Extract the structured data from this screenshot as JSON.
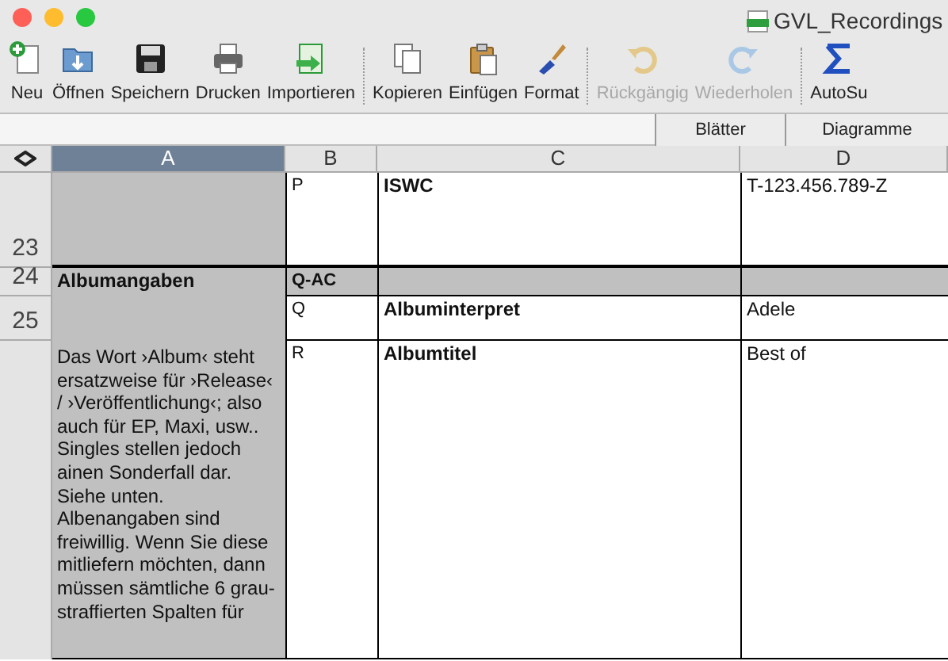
{
  "window": {
    "title": "GVL_Recordings"
  },
  "toolbar": [
    {
      "label": "Neu",
      "disabled": false
    },
    {
      "label": "Öffnen",
      "disabled": false
    },
    {
      "label": "Speichern",
      "disabled": false
    },
    {
      "label": "Drucken",
      "disabled": false
    },
    {
      "label": "Importieren",
      "disabled": false
    },
    {
      "label": "Kopieren",
      "disabled": false
    },
    {
      "label": "Einfügen",
      "disabled": false
    },
    {
      "label": "Format",
      "disabled": false
    },
    {
      "label": "Rückgängig",
      "disabled": true
    },
    {
      "label": "Wiederholen",
      "disabled": true
    },
    {
      "label": "AutoSu",
      "disabled": false
    }
  ],
  "ribbon_tabs": [
    {
      "label": "Blätter"
    },
    {
      "label": "Diagramme"
    }
  ],
  "columns": [
    {
      "label": "A",
      "selected": true
    },
    {
      "label": "B",
      "selected": false
    },
    {
      "label": "C",
      "selected": false
    },
    {
      "label": "D",
      "selected": false
    }
  ],
  "rows": [
    {
      "number": "23",
      "cells": [
        "",
        "P",
        "ISWC",
        "T-123.456.789-Z"
      ]
    },
    {
      "number": "24",
      "cells": [
        "Albumangaben",
        "Q-AC",
        "",
        ""
      ]
    },
    {
      "number": "25",
      "cells": [
        "",
        "Q",
        "Albuminterpret",
        "Adele"
      ]
    },
    {
      "cells": [
        "Das Wort ›Album‹ steht ersatzweise für ›Release‹ / ›Veröffentlichung‹; also auch für EP, Maxi, usw.. Singles stellen jedoch ainen Sonderfall dar. Siehe unten. Albenangaben sind freiwillig. Wenn Sie diese mitliefern möchten, dann müssen sämtliche 6 grau-straffierten Spalten für",
        "R",
        "Albumtitel",
        "Best of"
      ]
    }
  ]
}
